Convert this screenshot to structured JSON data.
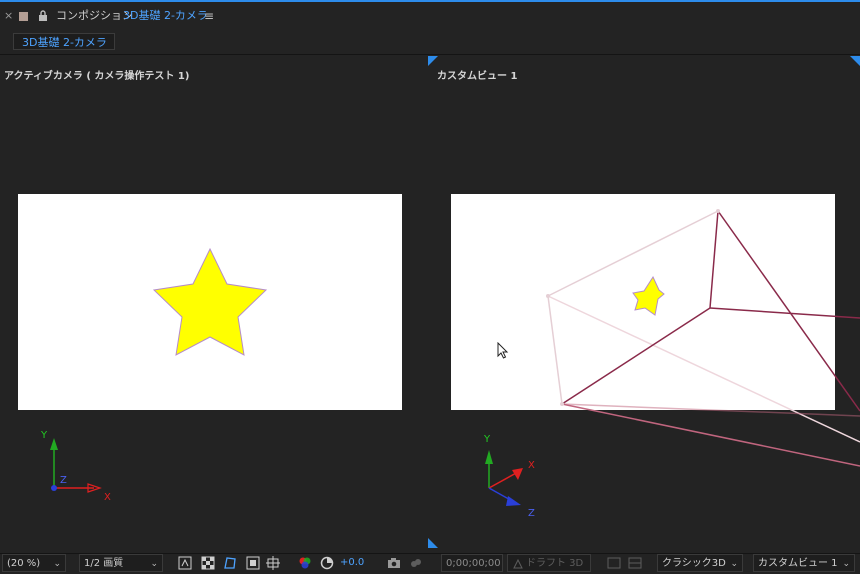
{
  "header": {
    "close_glyph": "×",
    "panel_label": "コンポジション",
    "comp_name": "3D基礎 2-カメラ",
    "menu_glyph": "≡"
  },
  "tab": {
    "label": "3D基礎 2-カメラ"
  },
  "views": [
    {
      "title": "アクティブカメラ ( カメラ操作テスト 1)"
    },
    {
      "title": "カスタムビュー 1"
    }
  ],
  "axes_left": {
    "y": "Y",
    "z": "Z",
    "x": "X"
  },
  "axes_right": {
    "y": "Y",
    "x": "X",
    "z": "Z"
  },
  "statusbar": {
    "zoom": "(20 %)",
    "resolution": "1/2 画質",
    "exposure": "+0.0",
    "timecode": "0;00;00;00",
    "draft_3d": "ドラフト 3D",
    "renderer": "クラシック3D",
    "view_select": "カスタムビュー 1"
  },
  "colors": {
    "accent": "#2d8ceb",
    "star_fill": "#ffff00",
    "axis_y": "#22aa22",
    "axis_x": "#e02020",
    "axis_z": "#2a3fd8",
    "camera_wire": "#8a2a4a"
  }
}
